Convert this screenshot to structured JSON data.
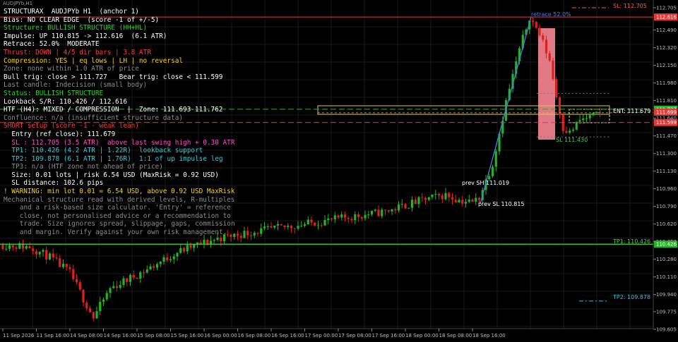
{
  "window": {
    "title": "AUDJPYb,H1"
  },
  "panel": {
    "lines": [
      {
        "text": "STRUCTURAX  AUDJPYb H1  (anchor 1)",
        "color": "#ffffff",
        "indent": 0
      },
      {
        "text": "Bias: NO CLEAR EDGE  (score -1 of +/-5)",
        "color": "#ffffff",
        "indent": 0
      },
      {
        "text": "Structure: BULLISH STRUCTURE (HH+HL)",
        "color": "#27d627",
        "indent": 0
      },
      {
        "text": "Impulse: UP 110.815 -> 112.616  (6.1 ATR)",
        "color": "#ffffff",
        "indent": 0
      },
      {
        "text": "Retrace: 52.0%  MODERATE",
        "color": "#ffffff",
        "indent": 0
      },
      {
        "text": "Thrust: DOWN | 4/5 dir bars | 3.8 ATR",
        "color": "#ff3b3b",
        "indent": 0
      },
      {
        "text": "Compression: YES | eq lows | LH | no reversal",
        "color": "#ffd400",
        "indent": 0
      },
      {
        "text": "Zone: none within 1.0 ATR of price",
        "color": "#8c8c8c",
        "indent": 0
      },
      {
        "text": "Bull trig: close > 111.727   Bear trig: close < 111.599",
        "color": "#ffffff",
        "indent": 0
      },
      {
        "text": "Last candle: Indecision (small body)",
        "color": "#8c8c8c",
        "indent": 0
      },
      {
        "text": "Status: BULLISH STRUCTURE",
        "color": "#27d627",
        "indent": 0
      },
      {
        "text": "Lookback S/R: 110.426 / 112.616",
        "color": "#ffffff",
        "indent": 0
      },
      {
        "text": "HTF (H4): MIXED / COMPRESSION  |  Zone: 111.693-111.762",
        "color": "#ffffff",
        "indent": 0
      },
      {
        "text": "Confluence: n/a (insufficient structure data)",
        "color": "#8c8c8c",
        "indent": 0
      },
      {
        "text": "SHORT setup (score -1 - weak lean)",
        "color": "#ff3b3b",
        "indent": 0
      },
      {
        "text": "Entry (ref close): 111.679",
        "color": "#ffffff",
        "indent": 2
      },
      {
        "text": "SL : 112.705 (3.5 ATR)  above last swing high + 0.30 ATR",
        "color": "#ff4fc8",
        "indent": 2
      },
      {
        "text": "TP1: 110.426 (4.2 ATR | 1.22R)  lookback support",
        "color": "#22d3e6",
        "indent": 2
      },
      {
        "text": "TP2: 109.878 (6.1 ATR | 1.76R)  1:1 of up impulse leg",
        "color": "#22d3e6",
        "indent": 2
      },
      {
        "text": "TP3: n/a (HTF zone not ahead of price)",
        "color": "#8c8c8c",
        "indent": 2
      },
      {
        "text": "Size: 0.01 lots | risk 6.54 USD (MaxRisk = 0.92 USD)",
        "color": "#ffffff",
        "indent": 2
      },
      {
        "text": "SL distance: 102.6 pips",
        "color": "#ffffff",
        "indent": 2
      },
      {
        "text": "! WARNING: min lot 0.01 = 6.54 USD, above 0.92 USD MaxRisk",
        "color": "#ffd400",
        "indent": 0
      },
      {
        "text": "Mechanical structure read with derived levels, R-multiples",
        "color": "#8c8c8c",
        "indent": 0
      },
      {
        "text": "and a risk-based size calculator. 'Entry' = reference",
        "color": "#8c8c8c",
        "indent": 4
      },
      {
        "text": "close, not personalised advice or a recommendation to",
        "color": "#8c8c8c",
        "indent": 4
      },
      {
        "text": "trade. Size ignores spread, slippage, gaps, commission",
        "color": "#8c8c8c",
        "indent": 4
      },
      {
        "text": "and margin. Verify against your own risk management.",
        "color": "#8c8c8c",
        "indent": 4
      }
    ]
  },
  "levels": [
    {
      "price": 112.705,
      "label": "SL: 112.705",
      "color": "#ff5a5a"
    },
    {
      "price": 110.426,
      "label": "TP1: 110.426",
      "color": "#46d646"
    },
    {
      "price": 109.878,
      "label": "TP2: 109.878",
      "color": "#35c6e0"
    }
  ],
  "annotations": {
    "retrace": "retrace 52.0%",
    "prev_sh": "prev SH 111.019",
    "prev_sl": "prev SL 110.815",
    "sl_swing": "SL 111.430",
    "entry": "ENT: 111.679"
  },
  "price_axis": {
    "ticks": [
      "112.705",
      "112.490",
      "112.320",
      "112.150",
      "111.980",
      "111.810",
      "111.640",
      "111.470",
      "111.300",
      "111.130",
      "110.960",
      "110.790",
      "110.620",
      "110.450",
      "110.280",
      "110.110",
      "109.940",
      "109.775",
      "109.605"
    ],
    "tags": [
      {
        "text": "112.616",
        "price": 112.616,
        "color": "#e23a3a"
      },
      {
        "text": "111.727",
        "price": 111.727,
        "color": "#27b427"
      },
      {
        "text": "111.699",
        "price": 111.699,
        "color": "#e23a3a"
      },
      {
        "text": "111.599",
        "price": 111.599,
        "color": "#e23a3a"
      },
      {
        "text": "110.426",
        "price": 110.426,
        "color": "#27b427"
      }
    ]
  },
  "time_axis": {
    "labels": [
      "11 Sep 2026",
      "11 Sep 16:00",
      "14 Sep 08:00",
      "14 Sep 16:00",
      "15 Sep 08:00",
      "15 Sep 16:00",
      "16 Sep 00:00",
      "16 Sep 08:00",
      "16 Sep 16:00",
      "17 Sep 00:00",
      "17 Sep 08:00",
      "17 Sep 16:00",
      "18 Sep 00:00",
      "18 Sep 08:00",
      "18 Sep 16:00"
    ]
  },
  "colors": {
    "bull": "#22b422",
    "bear": "#e0201e",
    "grid": "#1a1a1a"
  }
}
